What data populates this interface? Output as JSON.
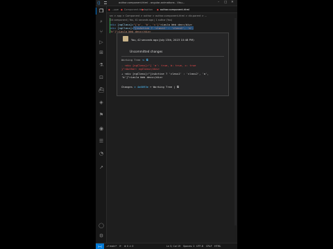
{
  "window": {
    "title": "author.component.html - angular-animations - Visu...",
    "minimize": "–",
    "maximize": "□",
    "close": "✕"
  },
  "tabs": [
    {
      "label": "...ppe"
    },
    {
      "label": "Component.html"
    },
    {
      "label": "option"
    },
    {
      "label": "author.component.html"
    }
  ],
  "breadcrumb": "src > app > Component > author > author.component.html > div.parent > ...",
  "editor": {
    "codelens": "Git component | You, 41 seconds ago | 1 author (You)",
    "line1": {
      "tag": "<div",
      "attr": " [ngClass]=",
      "str": "\"{'a', 'b', 'c'}\"",
      "rest": ">Lasla Web dev</div>"
    },
    "line2": {
      "tag": "<div",
      "attr": " [ngClass]=",
      "str": "\"[isActive ? 'class1' : 'class2', 'a',",
      "rest": ""
    },
    "line3": "'b']\">Lasla Web devs</div>"
  },
  "hover": {
    "author": "You, 42 seconds ago   (July 15th, 2023 10:48 PM)",
    "uncommitted": "Uncommitted changes",
    "working_tree": "Working Tree",
    "diff_minus_1": "- <div [ngClass]=\"{ 'a': true, b: true, c: true",
    "diff_minus_2": "}\">Author: ngClass</div>",
    "diff_plus_1": "+ <div [ngClass]=\"[isActive ? 'class1' : 'class2', 'a',",
    "diff_plus_2": "'b']\">Lasla Web devs</div>",
    "changes_prefix": "Changes",
    "changes_hash": "◇ 4a6093e",
    "changes_suffix": "↔ Working Tree  |  ⧉"
  },
  "statusbar": {
    "remote": "><",
    "branch": "⎇ main*",
    "sync": "⟳",
    "errors": "⊗ 0 ⚠ 0",
    "position": "Ln 3, Col 19",
    "spaces": "Spaces: 2",
    "encoding": "UTF-8",
    "eol": "CRLF",
    "language": "HTML"
  }
}
